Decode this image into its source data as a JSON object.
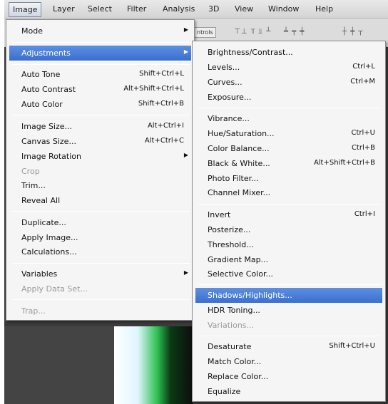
{
  "menubar": {
    "items": [
      "Image",
      "Layer",
      "Select",
      "Filter",
      "Analysis",
      "3D",
      "View",
      "Window",
      "Help"
    ]
  },
  "options_bar": {
    "control_label": "ntrols"
  },
  "image_menu": {
    "items": [
      {
        "label": "Mode",
        "shortcut": "",
        "submenu": true
      },
      {
        "label": "Adjustments",
        "shortcut": "",
        "submenu": true,
        "highlighted": true
      },
      {
        "label": "Auto Tone",
        "shortcut": "Shift+Ctrl+L"
      },
      {
        "label": "Auto Contrast",
        "shortcut": "Alt+Shift+Ctrl+L"
      },
      {
        "label": "Auto Color",
        "shortcut": "Shift+Ctrl+B"
      },
      {
        "label": "Image Size...",
        "shortcut": "Alt+Ctrl+I"
      },
      {
        "label": "Canvas Size...",
        "shortcut": "Alt+Ctrl+C"
      },
      {
        "label": "Image Rotation",
        "shortcut": "",
        "submenu": true
      },
      {
        "label": "Crop",
        "shortcut": "",
        "disabled": true
      },
      {
        "label": "Trim...",
        "shortcut": ""
      },
      {
        "label": "Reveal All",
        "shortcut": ""
      },
      {
        "label": "Duplicate...",
        "shortcut": ""
      },
      {
        "label": "Apply Image...",
        "shortcut": ""
      },
      {
        "label": "Calculations...",
        "shortcut": ""
      },
      {
        "label": "Variables",
        "shortcut": "",
        "submenu": true
      },
      {
        "label": "Apply Data Set...",
        "shortcut": "",
        "disabled": true
      },
      {
        "label": "Trap...",
        "shortcut": "",
        "disabled": true
      }
    ]
  },
  "adjustments_menu": {
    "items": [
      {
        "label": "Brightness/Contrast...",
        "shortcut": ""
      },
      {
        "label": "Levels...",
        "shortcut": "Ctrl+L"
      },
      {
        "label": "Curves...",
        "shortcut": "Ctrl+M"
      },
      {
        "label": "Exposure...",
        "shortcut": ""
      },
      {
        "label": "Vibrance...",
        "shortcut": ""
      },
      {
        "label": "Hue/Saturation...",
        "shortcut": "Ctrl+U"
      },
      {
        "label": "Color Balance...",
        "shortcut": "Ctrl+B"
      },
      {
        "label": "Black & White...",
        "shortcut": "Alt+Shift+Ctrl+B"
      },
      {
        "label": "Photo Filter...",
        "shortcut": ""
      },
      {
        "label": "Channel Mixer...",
        "shortcut": ""
      },
      {
        "label": "Invert",
        "shortcut": "Ctrl+I"
      },
      {
        "label": "Posterize...",
        "shortcut": ""
      },
      {
        "label": "Threshold...",
        "shortcut": ""
      },
      {
        "label": "Gradient Map...",
        "shortcut": ""
      },
      {
        "label": "Selective Color...",
        "shortcut": ""
      },
      {
        "label": "Shadows/Highlights...",
        "shortcut": "",
        "highlighted": true
      },
      {
        "label": "HDR Toning...",
        "shortcut": ""
      },
      {
        "label": "Variations...",
        "shortcut": "",
        "disabled": true
      },
      {
        "label": "Desaturate",
        "shortcut": "Shift+Ctrl+U"
      },
      {
        "label": "Match Color...",
        "shortcut": ""
      },
      {
        "label": "Replace Color...",
        "shortcut": ""
      },
      {
        "label": "Equalize",
        "shortcut": ""
      }
    ]
  },
  "colors": {
    "highlight": "#3b6fd0",
    "menu_bg": "#f5f5f5",
    "disabled_text": "#9a9a9a"
  },
  "icons": {
    "submenu_arrow": "triangle-right"
  }
}
